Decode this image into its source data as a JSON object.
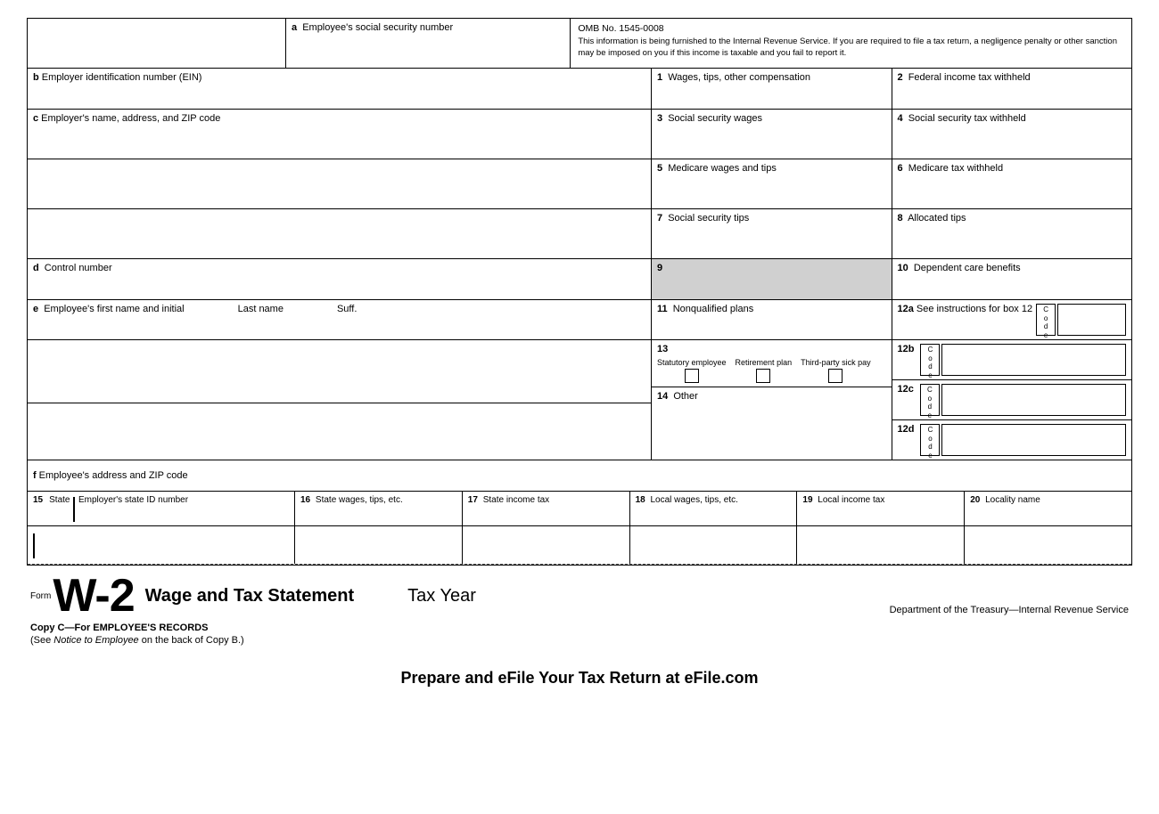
{
  "form": {
    "title": "W-2",
    "form_label": "Form",
    "subtitle": "Wage and Tax Statement",
    "tax_year": "Tax Year",
    "dept": "Department of the Treasury—Internal Revenue Service",
    "copy_line": "Copy C—For EMPLOYEE'S RECORDS",
    "notice": "(See Notice to Employee on the back of Copy B.)",
    "efile": "Prepare and eFile Your Tax Return at eFile.com"
  },
  "header": {
    "omb": "OMB No. 1545-0008",
    "note": "This information is being furnished to the Internal Revenue Service. If you are required to file a tax return, a negligence penalty or other sanction may be imposed on you if this income is taxable and you fail to report it."
  },
  "fields": {
    "a_label": "a",
    "a_text": "Employee's social security number",
    "b_label": "b",
    "b_text": "Employer identification number (EIN)",
    "c_label": "c",
    "c_text": "Employer's name, address, and ZIP code",
    "d_label": "d",
    "d_text": "Control number",
    "e_label": "e",
    "e_first": "Employee's first name and initial",
    "e_last": "Last name",
    "e_suff": "Suff.",
    "f_label": "f",
    "f_text": "Employee's address and ZIP code",
    "box1": "1",
    "box1_text": "Wages, tips, other compensation",
    "box2": "2",
    "box2_text": "Federal income tax withheld",
    "box3": "3",
    "box3_text": "Social security wages",
    "box4": "4",
    "box4_text": "Social security tax withheld",
    "box5": "5",
    "box5_text": "Medicare wages and tips",
    "box6": "6",
    "box6_text": "Medicare tax withheld",
    "box7": "7",
    "box7_text": "Social security tips",
    "box8": "8",
    "box8_text": "Allocated tips",
    "box9": "9",
    "box10": "10",
    "box10_text": "Dependent care benefits",
    "box11": "11",
    "box11_text": "Nonqualified plans",
    "box12a": "12a",
    "box12a_text": "See instructions for box 12",
    "box12b": "12b",
    "box12c": "12c",
    "box12d": "12d",
    "box13": "13",
    "box13_statutory": "Statutory employee",
    "box13_retirement": "Retirement plan",
    "box13_thirdparty": "Third-party sick pay",
    "box14": "14",
    "box14_text": "Other",
    "box15": "15",
    "box15_text": "State",
    "box15b_text": "Employer's state ID number",
    "box16": "16",
    "box16_text": "State wages, tips, etc.",
    "box17": "17",
    "box17_text": "State income tax",
    "box18": "18",
    "box18_text": "Local wages, tips, etc.",
    "box19": "19",
    "box19_text": "Local income tax",
    "box20": "20",
    "box20_text": "Locality name",
    "code_letters": [
      "C",
      "o",
      "d",
      "e"
    ]
  }
}
